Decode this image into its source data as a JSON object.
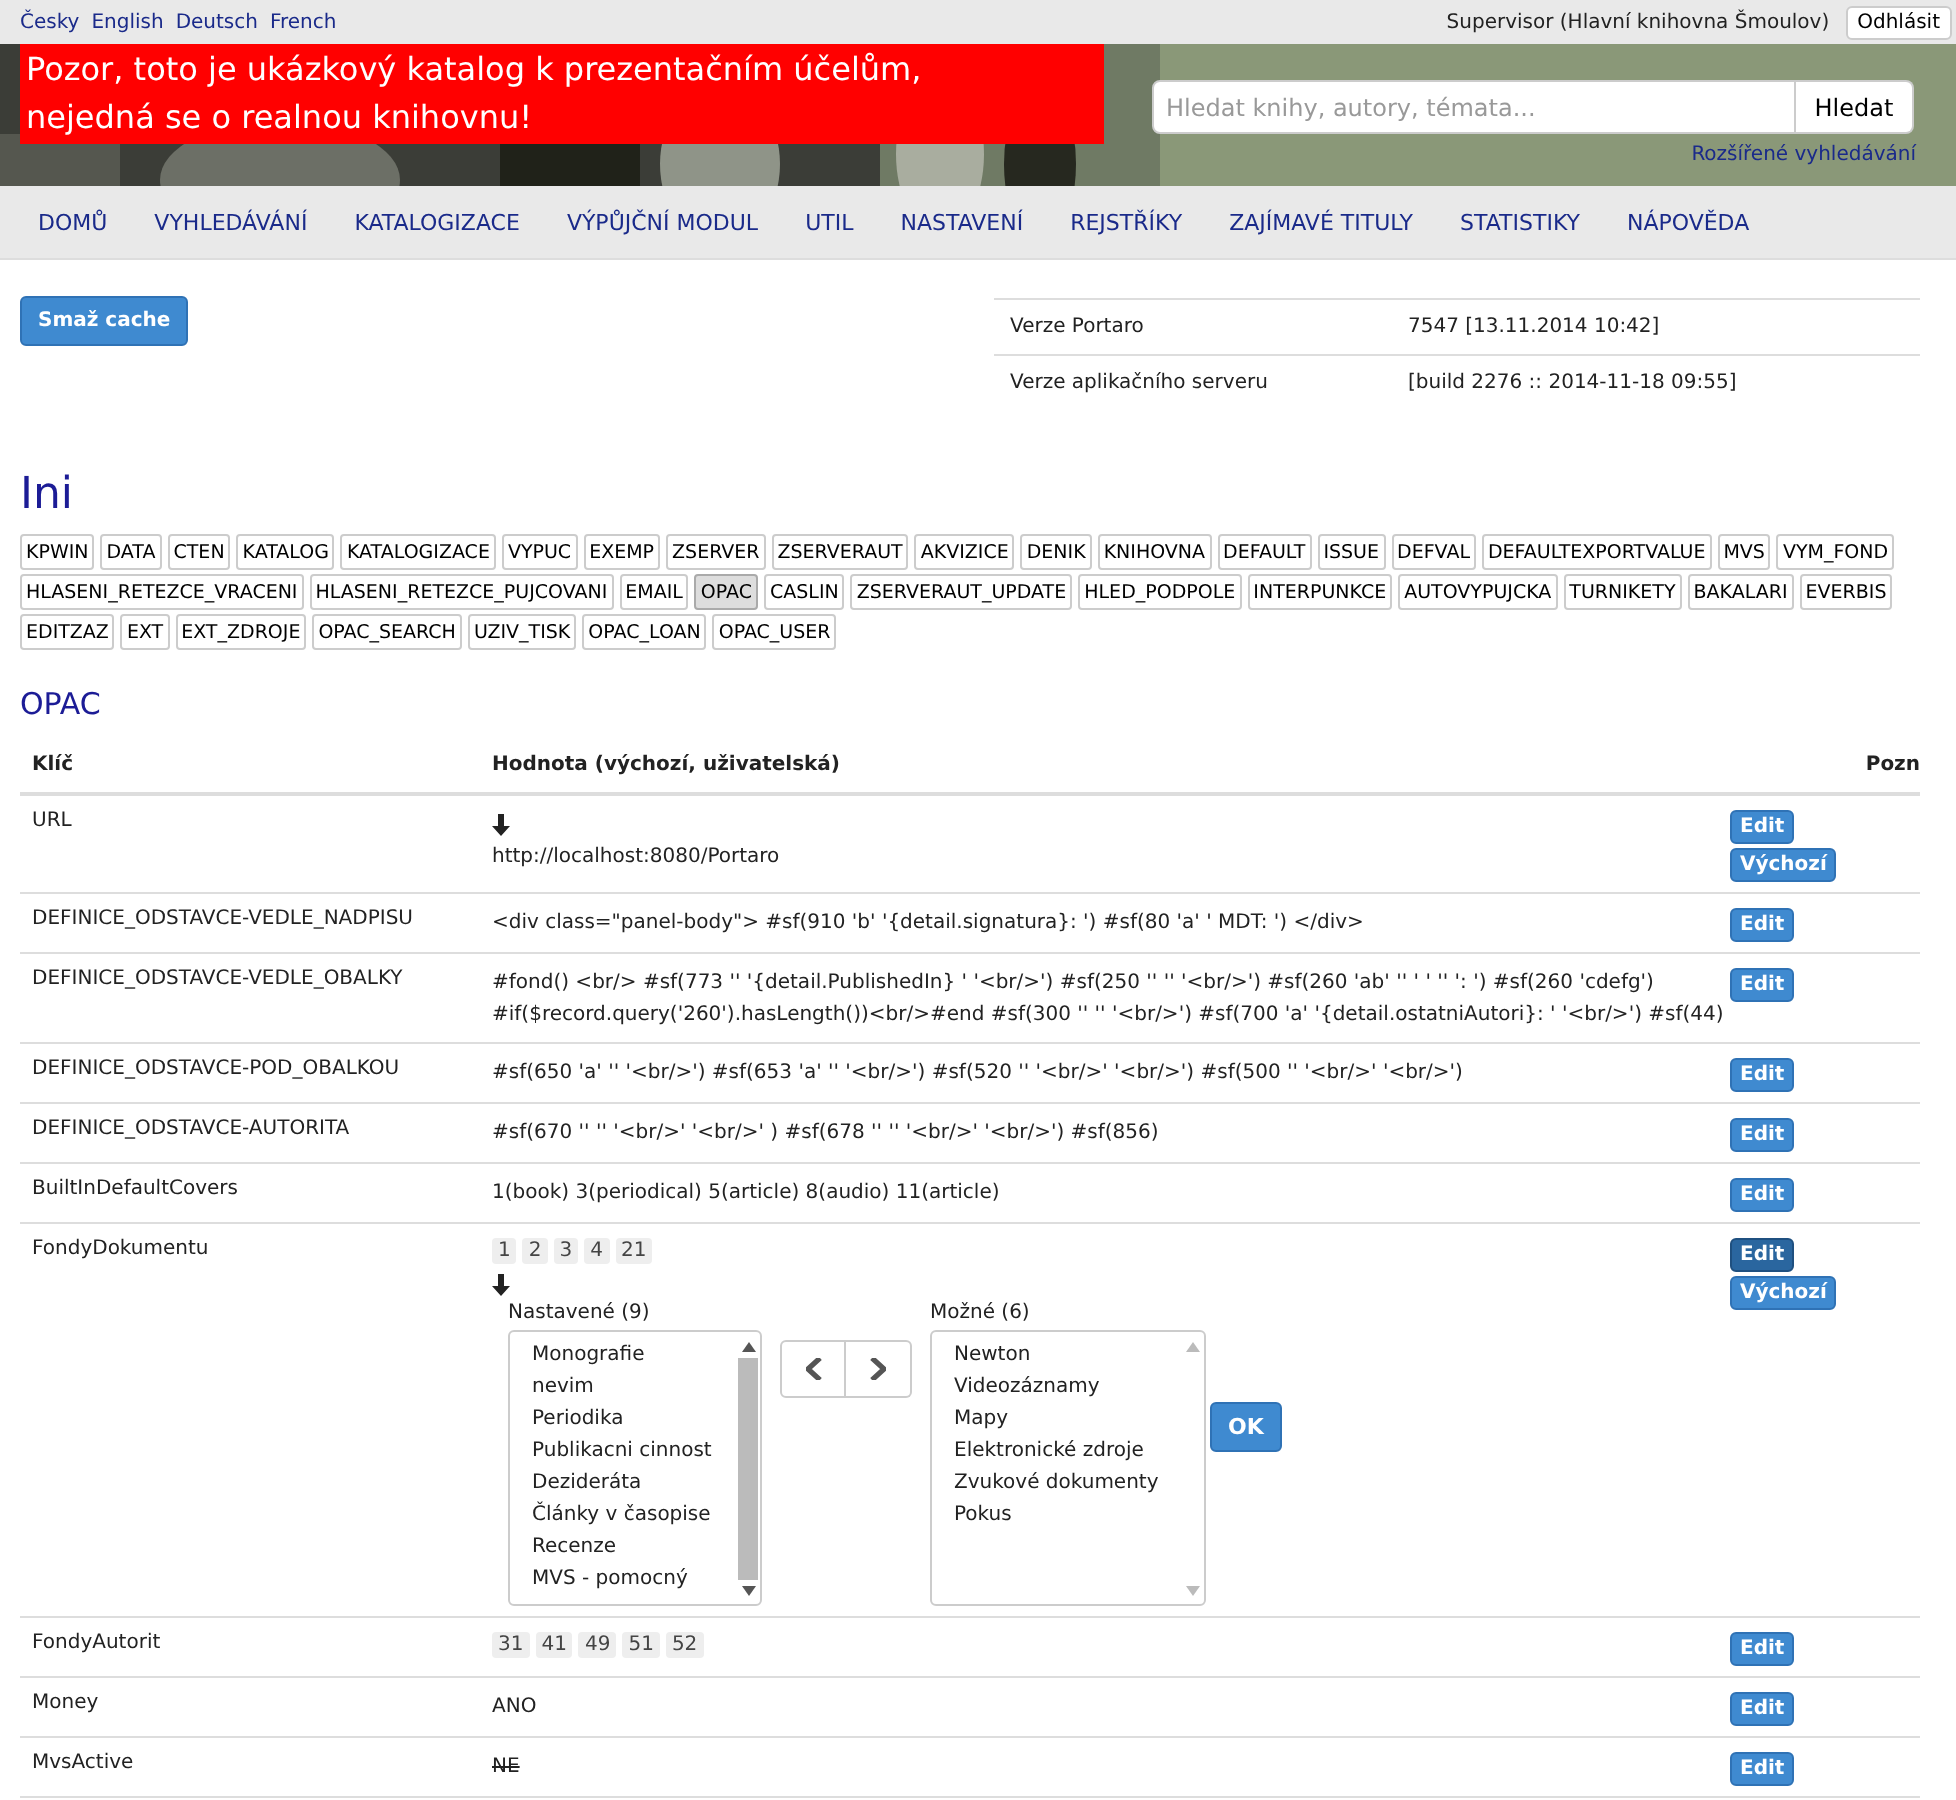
{
  "languages": [
    "Česky",
    "English",
    "Deutsch",
    "French"
  ],
  "user": "Supervisor (Hlavní knihovna Šmoulov)",
  "logout": "Odhlásit",
  "banner": "Pozor, toto je ukázkový katalog k prezentačním účelům, nejedná se o realnou knihovnu!",
  "search": {
    "placeholder": "Hledat knihy, autory, témata...",
    "button": "Hledat",
    "advanced": "Rozšířené vyhledávání"
  },
  "nav": [
    "DOMŮ",
    "VYHLEDÁVÁNÍ",
    "KATALOGIZACE",
    "VÝPŮJČNÍ MODUL",
    "UTIL",
    "NASTAVENÍ",
    "REJSTŘÍKY",
    "ZAJÍMAVÉ TITULY",
    "STATISTIKY",
    "NÁPOVĚDA"
  ],
  "clear_cache": "Smaž cache",
  "versions": [
    {
      "label": "Verze Portaro",
      "value": "7547 [13.11.2014 10:42]"
    },
    {
      "label": "Verze aplikačního serveru",
      "value": "[build 2276 :: 2014-11-18 09:55]"
    }
  ],
  "ini_title": "Ini",
  "sections": [
    {
      "label": "KPWIN",
      "selected": false
    },
    {
      "label": "DATA",
      "selected": false
    },
    {
      "label": "CTEN",
      "selected": false
    },
    {
      "label": "KATALOG",
      "selected": false
    },
    {
      "label": "KATALOGIZACE",
      "selected": false
    },
    {
      "label": "VYPUC",
      "selected": false
    },
    {
      "label": "EXEMP",
      "selected": false
    },
    {
      "label": "ZSERVER",
      "selected": false
    },
    {
      "label": "ZSERVERAUT",
      "selected": false
    },
    {
      "label": "AKVIZICE",
      "selected": false
    },
    {
      "label": "DENIK",
      "selected": false
    },
    {
      "label": "KNIHOVNA",
      "selected": false
    },
    {
      "label": "DEFAULT",
      "selected": false
    },
    {
      "label": "ISSUE",
      "selected": false
    },
    {
      "label": "DEFVAL",
      "selected": false
    },
    {
      "label": "DEFAULTEXPORTVALUE",
      "selected": false
    },
    {
      "label": "MVS",
      "selected": false
    },
    {
      "label": "VYM_FOND",
      "selected": false
    },
    {
      "label": "HLASENI_RETEZCE_VRACENI",
      "selected": false
    },
    {
      "label": "HLASENI_RETEZCE_PUJCOVANI",
      "selected": false
    },
    {
      "label": "EMAIL",
      "selected": false
    },
    {
      "label": "OPAC",
      "selected": true
    },
    {
      "label": "CASLIN",
      "selected": false
    },
    {
      "label": "ZSERVERAUT_UPDATE",
      "selected": false
    },
    {
      "label": "HLED_PODPOLE",
      "selected": false
    },
    {
      "label": "INTERPUNKCE",
      "selected": false
    },
    {
      "label": "AUTOVYPUJCKA",
      "selected": false
    },
    {
      "label": "TURNIKETY",
      "selected": false
    },
    {
      "label": "BAKALARI",
      "selected": false
    },
    {
      "label": "EVERBIS",
      "selected": false
    },
    {
      "label": "EDITZAZ",
      "selected": false
    },
    {
      "label": "EXT",
      "selected": false
    },
    {
      "label": "EXT_ZDROJE",
      "selected": false
    },
    {
      "label": "OPAC_SEARCH",
      "selected": false
    },
    {
      "label": "UZIV_TISK",
      "selected": false
    },
    {
      "label": "OPAC_LOAN",
      "selected": false
    },
    {
      "label": "OPAC_USER",
      "selected": false
    }
  ],
  "section_title": "OPAC",
  "table": {
    "columns": [
      "Klíč",
      "Hodnota (výchozí, uživatelská)",
      "Pozn"
    ],
    "rows": [
      {
        "key": "URL",
        "kind": "arrow",
        "value": "http://localhost:8080/Portaro",
        "buttons": [
          {
            "label": "Edit",
            "active": false
          },
          {
            "label": "Výchozí",
            "active": false
          }
        ]
      },
      {
        "key": "DEFINICE_ODSTAVCE-VEDLE_NADPISU",
        "kind": "text",
        "value": "<div class=\"panel-body\"> #sf(910 'b' '{detail.signatura}: ') #sf(80 'a' ' MDT: ') </div>",
        "buttons": [
          {
            "label": "Edit",
            "active": false
          }
        ]
      },
      {
        "key": "DEFINICE_ODSTAVCE-VEDLE_OBALKY",
        "kind": "text",
        "value": "#fond() <br/> #sf(773 '' '{detail.PublishedIn} ' '<br/>') #sf(250 '' '' '<br/>') #sf(260 'ab' '' ' ' '' ': ') #sf(260 'cdefg') #if($record.query('260').hasLength())<br/>#end #sf(300 '' '' '<br/>') #sf(700 'a' '{detail.ostatniAutori}: ' '<br/>') #sf(44)",
        "buttons": [
          {
            "label": "Edit",
            "active": false
          }
        ]
      },
      {
        "key": "DEFINICE_ODSTAVCE-POD_OBALKOU",
        "kind": "text",
        "value": "#sf(650 'a' '' '<br/>') #sf(653 'a' '' '<br/>') #sf(520 '' '<br/>' '<br/>') #sf(500 '' '<br/>' '<br/>')",
        "buttons": [
          {
            "label": "Edit",
            "active": false
          }
        ]
      },
      {
        "key": "DEFINICE_ODSTAVCE-AUTORITA",
        "kind": "text",
        "value": "#sf(670 '' '' '<br/>' '<br/>' ) #sf(678 '' '' '<br/>' '<br/>') #sf(856)",
        "buttons": [
          {
            "label": "Edit",
            "active": false
          }
        ]
      },
      {
        "key": "BuiltInDefaultCovers",
        "kind": "text",
        "value": "1(book) 3(periodical) 5(article) 8(audio) 11(article)",
        "buttons": [
          {
            "label": "Edit",
            "active": false
          }
        ]
      },
      {
        "key": "FondyDokumentu",
        "kind": "picker",
        "chips": [
          "1",
          "2",
          "3",
          "4",
          "21"
        ],
        "left": {
          "label": "Nastavené (9)",
          "items": [
            "Monografie",
            "nevim",
            "Periodika",
            "Publikacni cinnost",
            "Dezideráta",
            "Články v časopise",
            "Recenze",
            "MVS - pomocný"
          ]
        },
        "right": {
          "label": "Možné (6)",
          "items": [
            "Newton",
            "Videozáznamy",
            "Mapy",
            "Elektronické zdroje",
            "Zvukové dokumenty",
            "Pokus"
          ]
        },
        "ok": "OK",
        "buttons": [
          {
            "label": "Edit",
            "active": true
          },
          {
            "label": "Výchozí",
            "active": false
          }
        ]
      },
      {
        "key": "FondyAutorit",
        "kind": "chips",
        "chips": [
          "31",
          "41",
          "49",
          "51",
          "52"
        ],
        "buttons": [
          {
            "label": "Edit",
            "active": false
          }
        ]
      },
      {
        "key": "Money",
        "kind": "text",
        "value": "ANO",
        "buttons": [
          {
            "label": "Edit",
            "active": false
          }
        ]
      },
      {
        "key": "MvsActive",
        "kind": "text",
        "value": "NE",
        "struck": true,
        "buttons": [
          {
            "label": "Edit",
            "active": false
          }
        ]
      }
    ]
  }
}
